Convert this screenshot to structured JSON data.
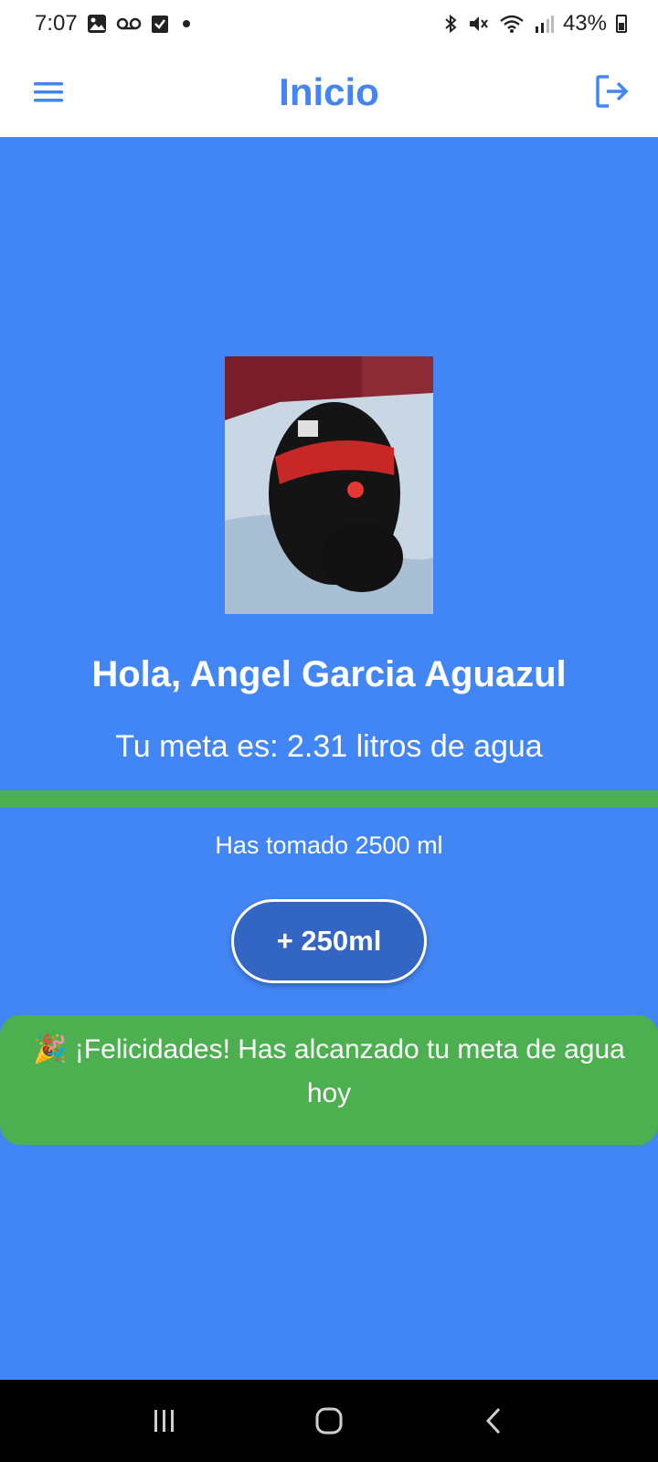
{
  "status_bar": {
    "time": "7:07",
    "battery": "43%",
    "left_icons": [
      "image-icon",
      "voicemail-icon",
      "checkbox-icon",
      "dot-icon"
    ],
    "right_icons": [
      "bluetooth-icon",
      "mute-icon",
      "wifi-icon",
      "signal-icon",
      "battery-icon"
    ]
  },
  "app_bar": {
    "title": "Inicio",
    "left_icon": "menu-icon",
    "right_icon": "logout-icon"
  },
  "main": {
    "avatar_icon": "profile-photo",
    "greeting": "Hola, Angel Garcia Aguazul",
    "goal": "Tu meta es: 2.31 litros de agua",
    "progress_fraction": 1.0,
    "consumed": "Has tomado 2500 ml",
    "add_button": "+ 250ml",
    "congrats": "🎉 ¡Felicidades! Has alcanzado tu meta de agua hoy"
  },
  "colors": {
    "background": "#4285f4",
    "accent_green": "#4caf50",
    "button": "#3266c2",
    "title": "#4285f4"
  },
  "nav_bar": {
    "icons": [
      "recent-apps-icon",
      "home-icon",
      "back-icon"
    ]
  }
}
